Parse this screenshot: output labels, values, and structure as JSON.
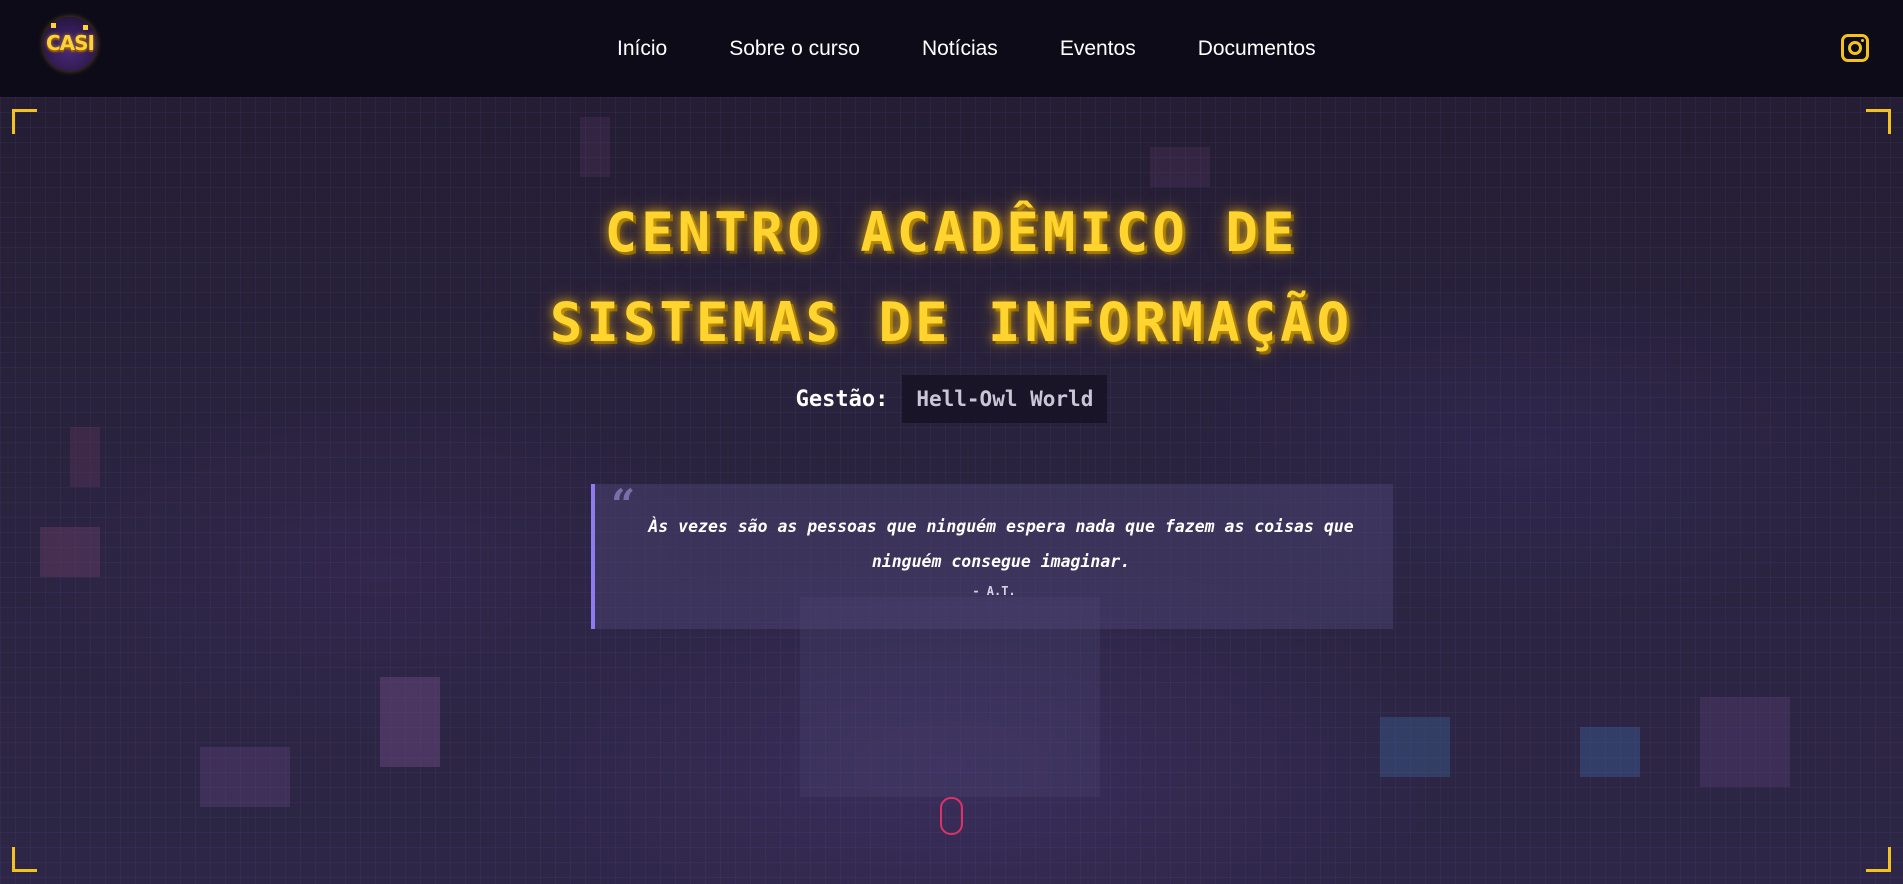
{
  "nav": {
    "logo_text": "CASI",
    "links": [
      "Início",
      "Sobre o curso",
      "Notícias",
      "Eventos",
      "Documentos"
    ],
    "social_icon": "instagram-icon"
  },
  "hero": {
    "title_line1": "CENTRO ACADÊMICO DE",
    "title_line2": "SISTEMAS DE INFORMAÇÃO",
    "gestao_label": "Gestão:",
    "gestao_value": "Hell-Owl World",
    "quote_mark": "“",
    "quote_text": "Às vezes são as pessoas que ninguém espera nada que fazem as coisas que ninguém consegue imaginar.",
    "quote_author": "- A.T.",
    "scroll_icon": "mouse-scroll-icon"
  },
  "colors": {
    "accent": "#ffd42e",
    "nav_bg": "#0d0b18",
    "quote_border": "#8c7cf0",
    "scroll_indicator": "#e0306a"
  }
}
